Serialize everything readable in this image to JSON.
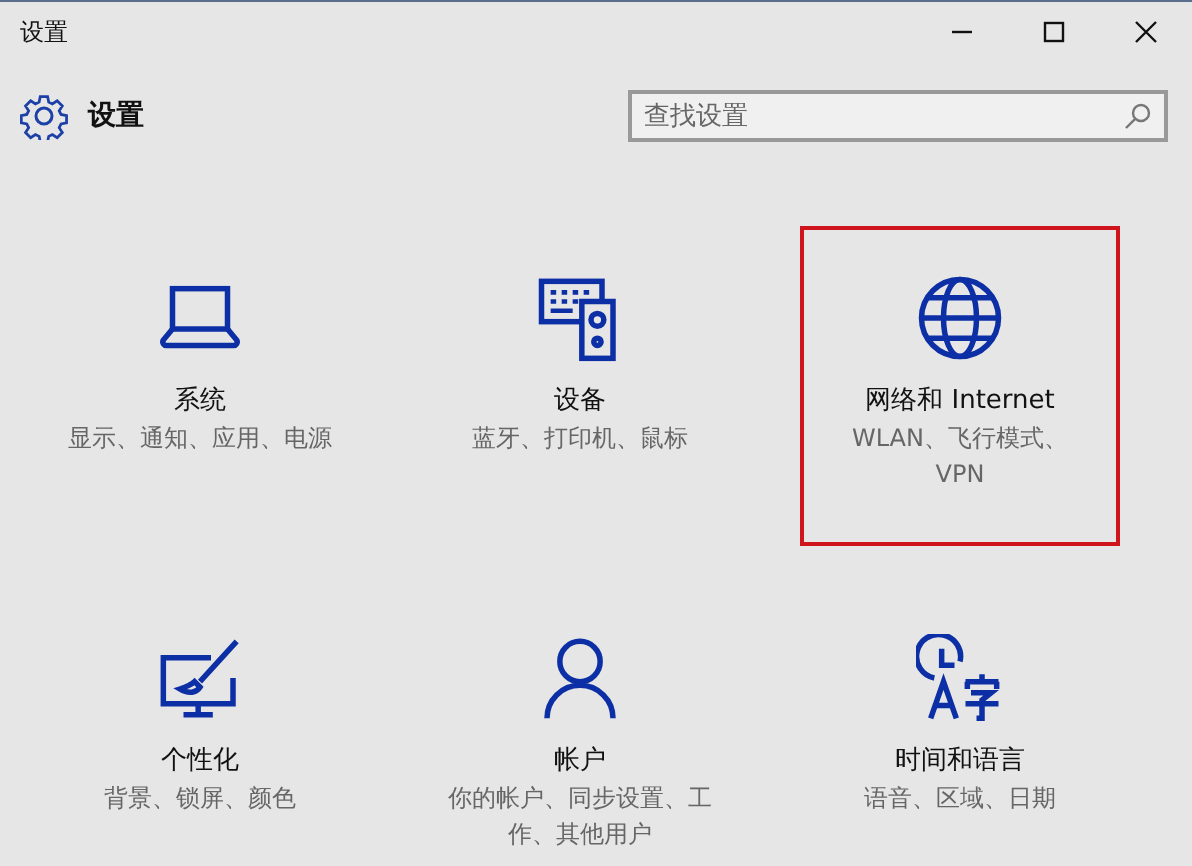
{
  "window": {
    "title": "设置"
  },
  "header": {
    "title": "设置",
    "search": {
      "placeholder": "查找设置"
    }
  },
  "tiles": [
    {
      "kind": "laptop",
      "title": "系统",
      "subtitle": "显示、通知、应用、电源",
      "selected": false
    },
    {
      "kind": "devices",
      "title": "设备",
      "subtitle": "蓝牙、打印机、鼠标",
      "selected": false
    },
    {
      "kind": "globe",
      "title": "网络和 Internet",
      "subtitle": "WLAN、飞行模式、VPN",
      "selected": true
    },
    {
      "kind": "personalize",
      "title": "个性化",
      "subtitle": "背景、锁屏、颜色",
      "selected": false
    },
    {
      "kind": "account",
      "title": "帐户",
      "subtitle": "你的帐户、同步设置、工作、其他用户",
      "selected": false
    },
    {
      "kind": "time-language",
      "title": "时间和语言",
      "subtitle": "语音、区域、日期",
      "selected": false
    }
  ]
}
